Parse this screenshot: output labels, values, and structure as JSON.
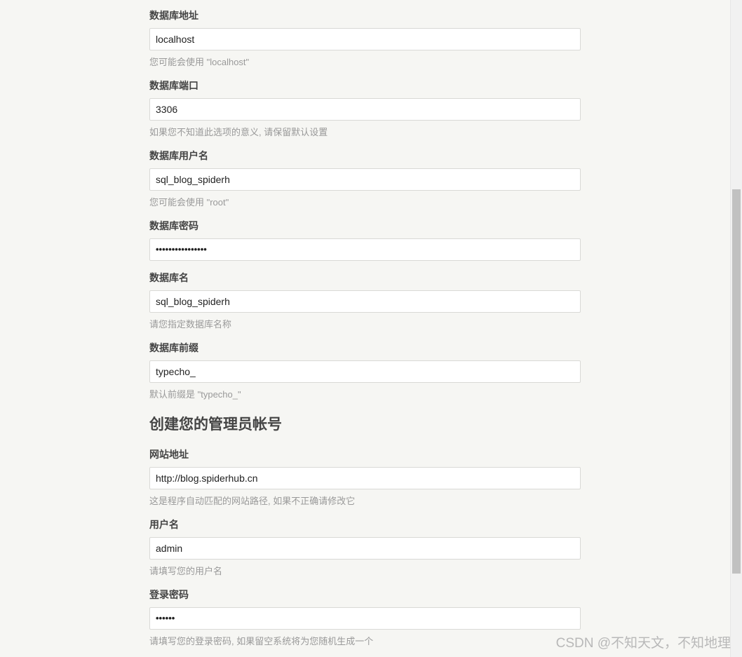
{
  "fields": [
    {
      "label": "数据库地址",
      "value": "localhost",
      "hint": "您可能会使用 \"localhost\""
    },
    {
      "label": "数据库端口",
      "value": "3306",
      "hint": "如果您不知道此选项的意义, 请保留默认设置"
    },
    {
      "label": "数据库用户名",
      "value": "sql_blog_spiderh",
      "hint": "您可能会使用 \"root\""
    },
    {
      "label": "数据库密码",
      "value": "••••••••••••••••",
      "hint": ""
    },
    {
      "label": "数据库名",
      "value": "sql_blog_spiderh",
      "hint": "请您指定数据库名称"
    },
    {
      "label": "数据库前缀",
      "value": "typecho_",
      "hint": "默认前缀是 \"typecho_\""
    }
  ],
  "admin_section": {
    "title": "创建您的管理员帐号",
    "fields": [
      {
        "label": "网站地址",
        "value": "http://blog.spiderhub.cn",
        "hint": "这是程序自动匹配的网站路径, 如果不正确请修改它"
      },
      {
        "label": "用户名",
        "value": "admin",
        "hint": "请填写您的用户名"
      },
      {
        "label": "登录密码",
        "value": "••••••",
        "hint": "请填写您的登录密码, 如果留空系统将为您随机生成一个"
      }
    ]
  },
  "watermark": "CSDN @不知天文，不知地理"
}
